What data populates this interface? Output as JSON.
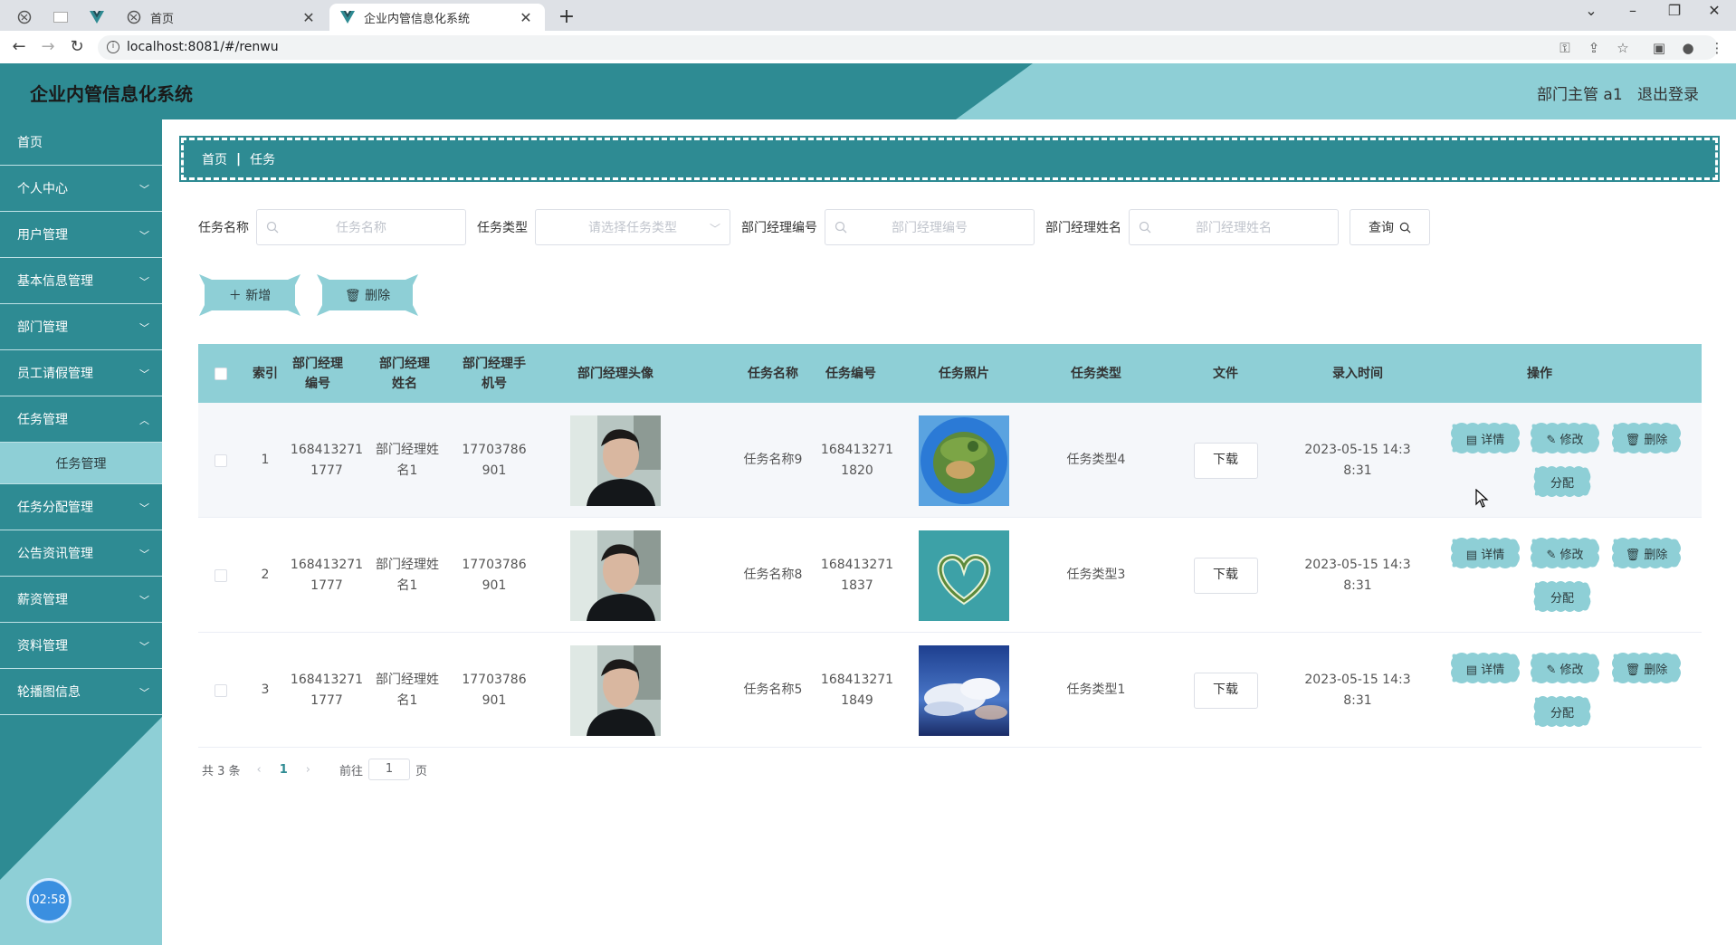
{
  "browser": {
    "tabs": [
      {
        "title": "首页",
        "active": false
      },
      {
        "title": "企业内管信息化系统",
        "active": true
      }
    ],
    "url": "localhost:8081/#/renwu"
  },
  "header": {
    "title": "企业内管信息化系统",
    "user": "部门主管 a1",
    "logout": "退出登录"
  },
  "sidebar": {
    "items": [
      {
        "label": "首页"
      },
      {
        "label": "个人中心"
      },
      {
        "label": "用户管理"
      },
      {
        "label": "基本信息管理"
      },
      {
        "label": "部门管理"
      },
      {
        "label": "员工请假管理"
      },
      {
        "label": "任务管理",
        "sub": "任务管理"
      },
      {
        "label": "任务分配管理"
      },
      {
        "label": "公告资讯管理"
      },
      {
        "label": "薪资管理"
      },
      {
        "label": "资料管理"
      },
      {
        "label": "轮播图信息"
      }
    ],
    "clock": "02:58"
  },
  "breadcrumb": {
    "home": "首页",
    "current": "任务"
  },
  "search": {
    "task_name_label": "任务名称",
    "task_name_placeholder": "任务名称",
    "task_type_label": "任务类型",
    "task_type_placeholder": "请选择任务类型",
    "mgr_no_label": "部门经理编号",
    "mgr_no_placeholder": "部门经理编号",
    "mgr_name_label": "部门经理姓名",
    "mgr_name_placeholder": "部门经理姓名",
    "query_label": "查询"
  },
  "actions": {
    "add_label": "新增",
    "delete_label": "删除"
  },
  "table": {
    "headers": {
      "index": "索引",
      "mgr_no": "部门经理编号",
      "mgr_name": "部门经理姓名",
      "mgr_phone": "部门经理手机号",
      "avatar": "部门经理头像",
      "task_name": "任务名称",
      "task_no": "任务编号",
      "task_photo": "任务照片",
      "task_type": "任务类型",
      "file": "文件",
      "created": "录入时间",
      "ops": "操作"
    },
    "rows": [
      {
        "index": "1",
        "mgr_no": "1684132711777",
        "mgr_name": "部门经理姓名1",
        "mgr_phone": "17703786901",
        "task_name": "任务名称9",
        "task_no": "1684132711820",
        "task_type": "任务类型4",
        "download": "下载",
        "created": "2023-05-15 14:38:31",
        "photo": "planet"
      },
      {
        "index": "2",
        "mgr_no": "1684132711777",
        "mgr_name": "部门经理姓名1",
        "mgr_phone": "17703786901",
        "task_name": "任务名称8",
        "task_no": "1684132711837",
        "task_type": "任务类型3",
        "download": "下载",
        "created": "2023-05-15 14:38:31",
        "photo": "heart-island"
      },
      {
        "index": "3",
        "mgr_no": "1684132711777",
        "mgr_name": "部门经理姓名1",
        "mgr_phone": "17703786901",
        "task_name": "任务名称5",
        "task_no": "1684132711849",
        "task_type": "任务类型1",
        "download": "下载",
        "created": "2023-05-15 14:38:31",
        "photo": "sky"
      }
    ],
    "ops": {
      "detail": "详情",
      "edit": "修改",
      "delete": "删除",
      "assign": "分配"
    }
  },
  "pager": {
    "total": "共 3 条",
    "current": "1",
    "goto": "前往",
    "goto_value": "1",
    "page_suffix": "页"
  },
  "colors": {
    "primary": "#2e8b93",
    "light": "#8ecfd6"
  }
}
